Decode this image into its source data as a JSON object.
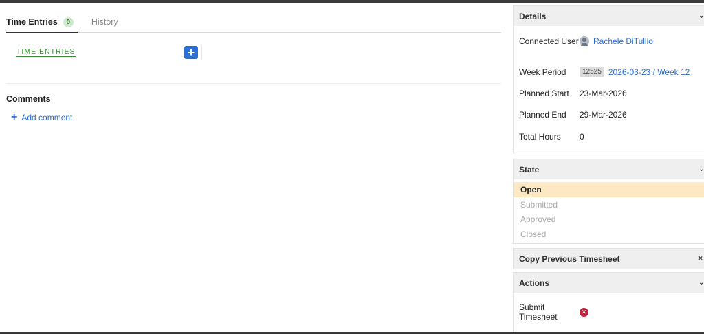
{
  "tabs": [
    {
      "label": "Time Entries",
      "badge": "0"
    },
    {
      "label": "History"
    }
  ],
  "time_entries": {
    "section_label": "TIME ENTRIES",
    "add_icon": "plus-icon"
  },
  "comments": {
    "title": "Comments",
    "add_label": "Add comment"
  },
  "details": {
    "title": "Details",
    "connected_user_label": "Connected User",
    "connected_user_value": "Rachele DiTullio",
    "week_period_label": "Week Period",
    "week_period_id": "12525",
    "week_period_value": "2026-03-23 / Week 12",
    "planned_start_label": "Planned Start",
    "planned_start_value": "23-Mar-2026",
    "planned_end_label": "Planned End",
    "planned_end_value": "29-Mar-2026",
    "total_hours_label": "Total Hours",
    "total_hours_value": "0"
  },
  "state": {
    "title": "State",
    "items": [
      "Open",
      "Submitted",
      "Approved",
      "Closed"
    ],
    "current": "Open"
  },
  "copy_previous": {
    "title": "Copy Previous Timesheet"
  },
  "actions": {
    "title": "Actions",
    "submit_label": "Submit Timesheet",
    "submit_icon": "error-icon"
  },
  "colors": {
    "accent_blue": "#2b6fd6",
    "green": "#2e8b2e",
    "state_highlight": "#fde8c4",
    "error_red": "#c0203a"
  }
}
